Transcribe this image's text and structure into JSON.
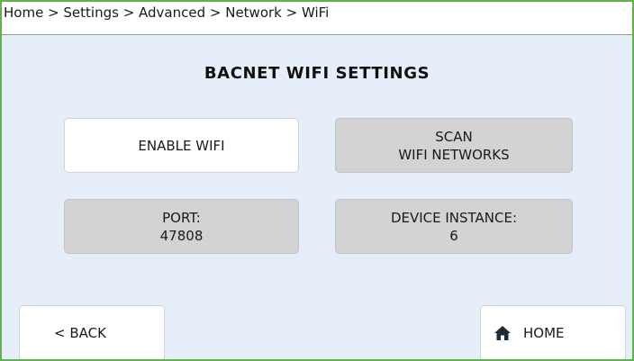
{
  "breadcrumb": "Home > Settings > Advanced > Network > WiFi",
  "title": "BACNET WIFI SETTINGS",
  "buttons": {
    "enable_wifi": "ENABLE WIFI",
    "scan_line1": "SCAN",
    "scan_line2": "WIFI NETWORKS",
    "port_label": "PORT:",
    "port_value": "47808",
    "device_label": "DEVICE INSTANCE:",
    "device_value": "6"
  },
  "nav": {
    "back": "< BACK",
    "home": "HOME",
    "home_icon": "home-icon"
  },
  "colors": {
    "frame_border": "#5fb34a",
    "background": "#e6eefa",
    "tile_active": "#ffffff",
    "tile_inactive": "#d3d3d3"
  }
}
